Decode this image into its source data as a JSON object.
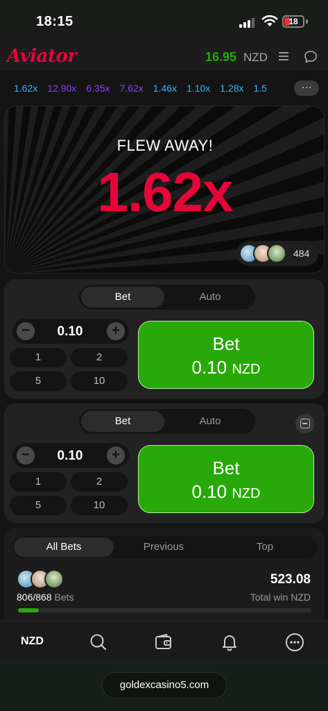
{
  "status": {
    "time": "18:15",
    "battery": "18",
    "colors": {
      "battery_low": "#e8323f"
    }
  },
  "header": {
    "logo": "Aviator",
    "balance": "16.95",
    "currency": "NZD",
    "icons": [
      "menu-icon",
      "chat-icon"
    ],
    "colors": {
      "logo": "#e50539",
      "balance": "#28a909"
    }
  },
  "history": {
    "multipliers": [
      {
        "value": "1.62x",
        "color": "#34b4ff"
      },
      {
        "value": "12.90x",
        "color": "#913ef8"
      },
      {
        "value": "6.35x",
        "color": "#913ef8"
      },
      {
        "value": "7.62x",
        "color": "#913ef8"
      },
      {
        "value": "1.46x",
        "color": "#34b4ff"
      },
      {
        "value": "1.10x",
        "color": "#34b4ff"
      },
      {
        "value": "1.28x",
        "color": "#34b4ff"
      },
      {
        "value": "1.5",
        "color": "#34b4ff"
      }
    ],
    "more_icon": "ellipsis-icon"
  },
  "game": {
    "status": "FLEW AWAY!",
    "multiplier": "1.62x",
    "players_count": "484"
  },
  "bet_panels": [
    {
      "tabs": [
        "Bet",
        "Auto"
      ],
      "active_tab": "Bet",
      "stake": "0.10",
      "minus": "−",
      "plus": "+",
      "quick_amounts": [
        "1",
        "2",
        "5",
        "10"
      ],
      "bet_label": "Bet",
      "bet_amount": "0.10",
      "bet_currency": "NZD"
    },
    {
      "tabs": [
        "Bet",
        "Auto"
      ],
      "active_tab": "Bet",
      "stake": "0.10",
      "minus": "−",
      "plus": "+",
      "quick_amounts": [
        "1",
        "2",
        "5",
        "10"
      ],
      "bet_label": "Bet",
      "bet_amount": "0.10",
      "bet_currency": "NZD",
      "remove_icon": "remove-panel-icon"
    }
  ],
  "bets": {
    "tabs": [
      "All Bets",
      "Previous",
      "Top"
    ],
    "active_tab": "All Bets",
    "count": "806/868",
    "count_label": "Bets",
    "total_win": "523.08",
    "total_win_label": "Total win NZD",
    "progress_fraction": 0.07
  },
  "nav": {
    "currency": "NZD",
    "icons": [
      "search-icon",
      "wallet-icon",
      "bell-icon",
      "more-icon"
    ]
  },
  "browser": {
    "url": "goldexcasino5.com"
  },
  "colors": {
    "bet_green": "#28a909",
    "accent_red": "#e50539",
    "mult_blue": "#34b4ff",
    "mult_purple": "#913ef8"
  }
}
